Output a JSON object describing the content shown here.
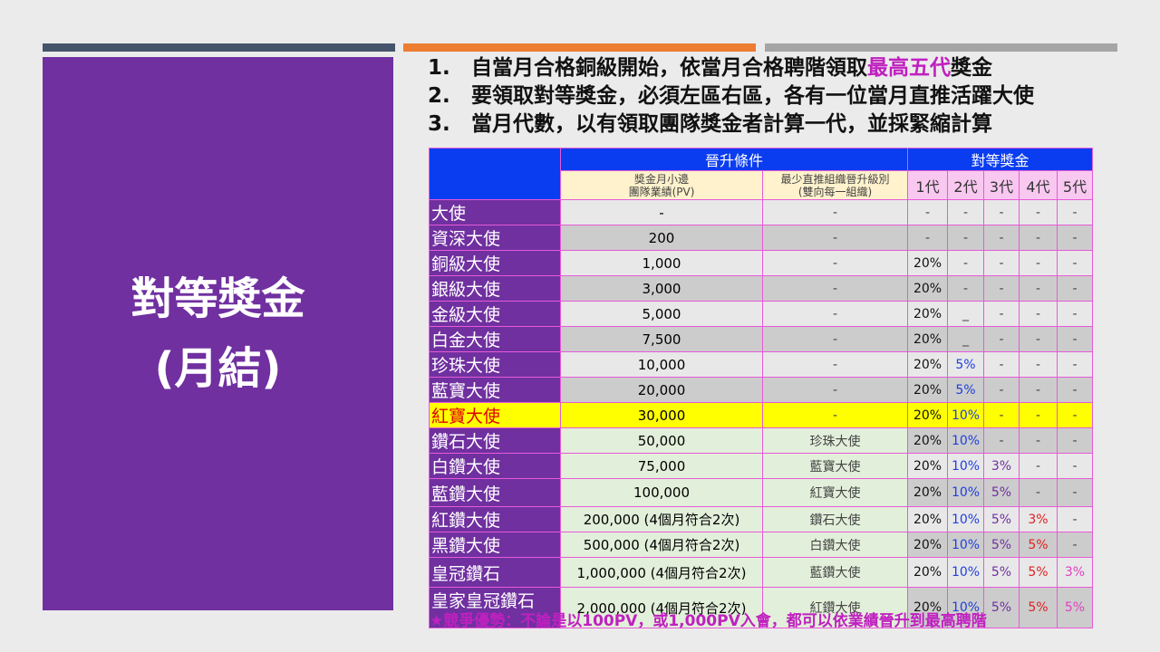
{
  "title_line1": "對等獎金",
  "title_line2": "(月結)",
  "points": [
    {
      "num": "1.",
      "text": "自當月合格銅級開始，依當月合格聘階領取",
      "highlight": "最高五代",
      "after": "獎金"
    },
    {
      "num": "2.",
      "text": "要領取對等獎金，必須左區右區，各有一位當月直推活躍大使"
    },
    {
      "num": "3.",
      "text": "當月代數，以有領取團隊獎金者計算一代，並採緊縮計算"
    }
  ],
  "table": {
    "group_promotion": "晉升條件",
    "group_bonus": "對等獎金",
    "col_pv": "獎金月小邊\n團隊業績(PV)",
    "col_min": "最少直推組織晉升級別\n(雙向每一組織)",
    "gens": [
      "1代",
      "2代",
      "3代",
      "4代",
      "5代"
    ],
    "rows": [
      {
        "name": "大使",
        "pv": "-",
        "min": "-",
        "b": [
          "-",
          "-",
          "-",
          "-",
          "-"
        ]
      },
      {
        "name": "資深大使",
        "pv": "200",
        "min": "-",
        "b": [
          "-",
          "-",
          "-",
          "-",
          "-"
        ]
      },
      {
        "name": "銅級大使",
        "pv": "1,000",
        "min": "-",
        "b": [
          "20%",
          "-",
          "-",
          "-",
          "-"
        ]
      },
      {
        "name": "銀級大使",
        "pv": "3,000",
        "min": "-",
        "b": [
          "20%",
          "-",
          "-",
          "-",
          "-"
        ]
      },
      {
        "name": "金級大使",
        "pv": "5,000",
        "min": "-",
        "b": [
          "20%",
          "_",
          "-",
          "-",
          "-"
        ]
      },
      {
        "name": "白金大使",
        "pv": "7,500",
        "min": "-",
        "b": [
          "20%",
          "_",
          "-",
          "-",
          "-"
        ]
      },
      {
        "name": "珍珠大使",
        "pv": "10,000",
        "min": "-",
        "b": [
          "20%",
          "5%",
          "-",
          "-",
          "-"
        ]
      },
      {
        "name": "藍寶大使",
        "pv": "20,000",
        "min": "-",
        "b": [
          "20%",
          "5%",
          "-",
          "-",
          "-"
        ]
      },
      {
        "name": "紅寶大使",
        "pv": "30,000",
        "min": "-",
        "b": [
          "20%",
          "10%",
          "-",
          "-",
          "-"
        ],
        "highlight": true
      },
      {
        "name": "鑽石大使",
        "pv": "50,000",
        "min": "珍珠大使",
        "b": [
          "20%",
          "10%",
          "-",
          "-",
          "-"
        ]
      },
      {
        "name": "白鑽大使",
        "pv": "75,000",
        "min": "藍寶大使",
        "b": [
          "20%",
          "10%",
          "3%",
          "-",
          "-"
        ]
      },
      {
        "name": "藍鑽大使",
        "pv": "100,000",
        "min": "紅寶大使",
        "b": [
          "20%",
          "10%",
          "5%",
          "-",
          "-"
        ]
      },
      {
        "name": "紅鑽大使",
        "pv": "200,000 (4個月符合2次)",
        "min": "鑽石大使",
        "b": [
          "20%",
          "10%",
          "5%",
          "3%",
          "-"
        ]
      },
      {
        "name": "黑鑽大使",
        "pv": "500,000 (4個月符合2次)",
        "min": "白鑽大使",
        "b": [
          "20%",
          "10%",
          "5%",
          "5%",
          "-"
        ]
      },
      {
        "name": "皇冠鑽石",
        "pv": "1,000,000 (4個月符合2次)",
        "min": "藍鑽大使",
        "b": [
          "20%",
          "10%",
          "5%",
          "5%",
          "3%"
        ]
      },
      {
        "name": "皇家皇冠鑽石",
        "pv": "2,000,000 (4個月符合2次)",
        "min": "紅鑽大使",
        "b": [
          "20%",
          "10%",
          "5%",
          "5%",
          "5%"
        ]
      }
    ]
  },
  "footnote": "★競爭優勢：不論是以100PV，或1,000PV入會，都可以依業績晉升到最高聘階",
  "colors": {
    "purple": "#7030a0",
    "header_blue": "#0a3cf0",
    "highlight_yellow": "#ffff00"
  }
}
